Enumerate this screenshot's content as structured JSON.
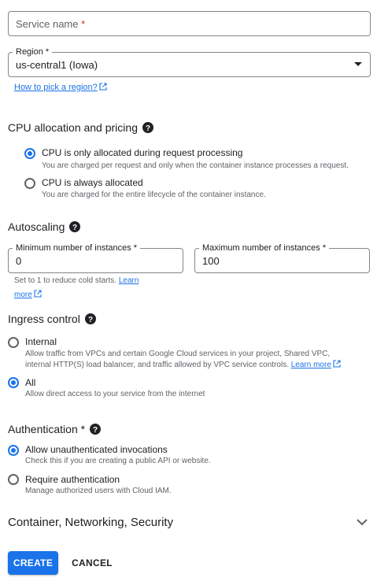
{
  "service_name": {
    "placeholder": "Service name",
    "required_mark": "*"
  },
  "region": {
    "label": "Region *",
    "value": "us-central1 (Iowa)",
    "help_link": "How to pick a region?"
  },
  "cpu": {
    "title": "CPU allocation and pricing",
    "options": [
      {
        "label": "CPU is only allocated during request processing",
        "desc": "You are charged per request and only when the container instance processes a request.",
        "selected": true
      },
      {
        "label": "CPU is always allocated",
        "desc": "You are charged for the entire lifecycle of the container instance.",
        "selected": false
      }
    ]
  },
  "autoscaling": {
    "title": "Autoscaling",
    "min_label": "Minimum number of instances *",
    "min_value": "0",
    "max_label": "Maximum number of instances *",
    "max_value": "100",
    "hint": "Set to 1 to reduce cold starts.",
    "hint_link_1": "Learn",
    "hint_link_2": "more"
  },
  "ingress": {
    "title": "Ingress control",
    "options": [
      {
        "label": "Internal",
        "desc_1": "Allow traffic from VPCs and certain Google Cloud services in your project, Shared VPC,",
        "desc_2": "internal HTTP(S) load balancer, and traffic allowed by VPC service controls.",
        "link": "Learn more",
        "selected": false
      },
      {
        "label": "All",
        "desc": "Allow direct access to your service from the internet",
        "selected": true
      }
    ]
  },
  "authentication": {
    "title": "Authentication *",
    "options": [
      {
        "label": "Allow unauthenticated invocations",
        "desc": "Check this if you are creating a public API or website.",
        "selected": true
      },
      {
        "label": "Require authentication",
        "desc": "Manage authorized users with Cloud IAM.",
        "selected": false
      }
    ]
  },
  "expander": {
    "title": "Container, Networking, Security",
    "icon": "chevron-down-icon"
  },
  "actions": {
    "create": "CREATE",
    "cancel": "CANCEL"
  },
  "colors": {
    "accent": "#1a73e8",
    "required": "#d93025",
    "border": "#80868b"
  }
}
